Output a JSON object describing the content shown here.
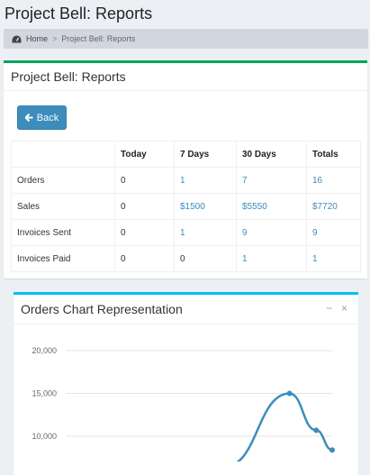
{
  "page": {
    "title": "Project Bell: Reports"
  },
  "breadcrumb": {
    "home": "Home",
    "separator": ">",
    "current": "Project Bell: Reports"
  },
  "box": {
    "title": "Project Bell: Reports",
    "back_label": "Back"
  },
  "table": {
    "headers": [
      "",
      "Today",
      "7 Days",
      "30 Days",
      "Totals"
    ],
    "rows": [
      {
        "label": "Orders",
        "today": "0",
        "seven": "1",
        "thirty": "7",
        "total": "16"
      },
      {
        "label": "Sales",
        "today": "0",
        "seven": "$1500",
        "thirty": "$5550",
        "total": "$7720"
      },
      {
        "label": "Invoices Sent",
        "today": "0",
        "seven": "1",
        "thirty": "9",
        "total": "9"
      },
      {
        "label": "Invoices Paid",
        "today": "0",
        "seven": "0",
        "thirty": "1",
        "total": "1"
      }
    ]
  },
  "chart": {
    "title": "Orders Chart Representation",
    "minimize": "−",
    "close": "×"
  },
  "colors": {
    "accent": "#3c8dbc",
    "box_border": "#00a65a",
    "chart_border": "#00c0ef",
    "line": "#3c8dbc"
  },
  "chart_data": {
    "type": "line",
    "title": "Orders Chart Representation",
    "yticks": [
      "20,000",
      "15,000",
      "10,000"
    ],
    "ylim": [
      8000,
      21000
    ],
    "grid": true,
    "series": [
      {
        "values": [
          {
            "x": 0.6,
            "y": 6500
          },
          {
            "x": 0.84,
            "y": 15000
          },
          {
            "x": 0.94,
            "y": 10700
          },
          {
            "x": 1.0,
            "y": 8400
          }
        ]
      }
    ]
  }
}
